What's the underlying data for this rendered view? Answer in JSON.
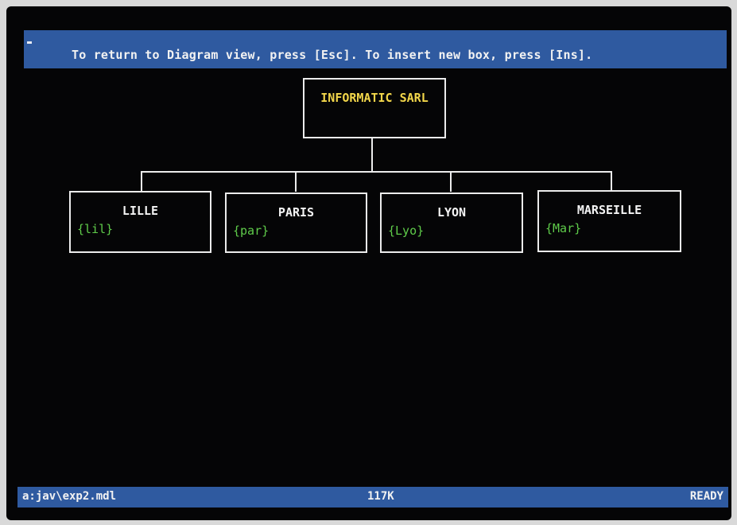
{
  "header": {
    "hint": "To return to Diagram view, press [Esc]. To insert new box, press [Ins]."
  },
  "org_chart": {
    "root": {
      "name": "INFORMATIC SARL"
    },
    "children": [
      {
        "name": "LILLE",
        "code": "{lil}"
      },
      {
        "name": "PARIS",
        "code": "{par}"
      },
      {
        "name": "LYON",
        "code": "{Lyo}"
      },
      {
        "name": "MARSEILLE",
        "code": "{Mar}"
      }
    ]
  },
  "status_bar": {
    "file_path": "a:jav\\exp2.mdl",
    "memory": "117K",
    "state": "READY"
  },
  "colors": {
    "bar_background": "#2f5aa0",
    "screen_background": "#050506",
    "root_text": "#f2d64a",
    "code_text": "#5fcc4a",
    "box_border": "#ececec"
  }
}
